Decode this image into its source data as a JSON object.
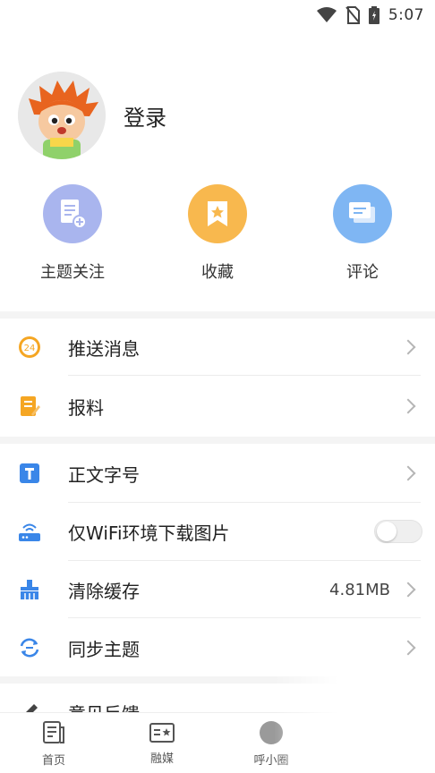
{
  "status_bar": {
    "time": "5:07"
  },
  "profile": {
    "login_label": "登录"
  },
  "quick_actions": [
    {
      "label": "主题关注",
      "icon": "topic-follow-icon",
      "color": "#a9b5ee"
    },
    {
      "label": "收藏",
      "icon": "favorite-icon",
      "color": "#f8b84e"
    },
    {
      "label": "评论",
      "icon": "comment-icon",
      "color": "#7fb6f3"
    }
  ],
  "menu": {
    "push_messages": {
      "label": "推送消息"
    },
    "report": {
      "label": "报料"
    },
    "font_size": {
      "label": "正文字号"
    },
    "wifi_images": {
      "label": "仅WiFi环境下载图片",
      "enabled": false
    },
    "clear_cache": {
      "label": "清除缓存",
      "value": "4.81MB"
    },
    "sync_theme": {
      "label": "同步主题"
    },
    "feedback": {
      "label": "意见反馈"
    }
  },
  "tab_bar": [
    {
      "label": "首页",
      "icon": "home-news-icon"
    },
    {
      "label": "融媒",
      "icon": "media-card-icon"
    },
    {
      "label": "呼小圈",
      "icon": "circle-icon"
    }
  ]
}
